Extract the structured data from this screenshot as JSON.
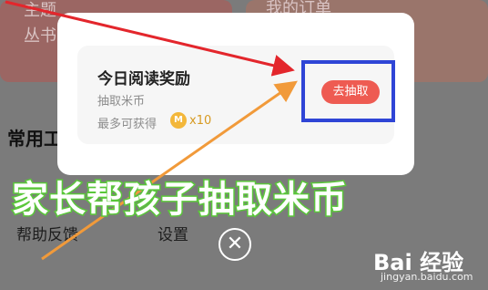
{
  "background": {
    "cards": [
      {
        "line1": "主题",
        "line2": "丛书"
      },
      {
        "line1": "我的订单"
      }
    ],
    "section_heading": "常用工",
    "menu": [
      "帮助反馈",
      "设置"
    ]
  },
  "modal": {
    "title": "今日阅读奖励",
    "subtitle": "抽取米币",
    "reward_prefix": "最多可获得",
    "coin_symbol": "M",
    "reward_multiplier": "x10",
    "action_button": "去抽取"
  },
  "close_symbol": "✕",
  "caption": "家长帮孩子抽取米币",
  "watermark": {
    "logo": "Bai 经验",
    "url": "jingyan.baidu.com"
  },
  "colors": {
    "button": "#ee5b52",
    "highlight_box": "#2f45d6",
    "caption_stroke": "#5ac73a",
    "arrow_red": "#e3262c",
    "arrow_orange": "#f19a3a"
  }
}
